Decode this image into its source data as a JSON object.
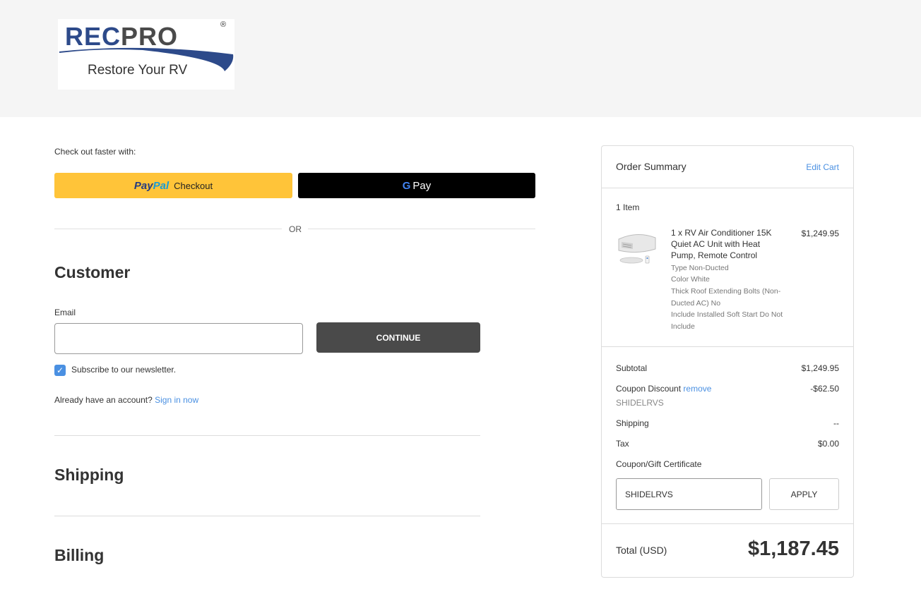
{
  "header": {
    "logo": {
      "brand_rec": "REC",
      "brand_pro": "PRO",
      "reg_mark": "®",
      "tagline": "Restore Your RV"
    }
  },
  "express": {
    "label": "Check out faster with:",
    "paypal": {
      "part1": "Pay",
      "part2": "Pal",
      "suffix": "Checkout"
    },
    "gpay": {
      "g": "G",
      "pay": "Pay"
    },
    "or": "OR"
  },
  "customer": {
    "title": "Customer",
    "email_label": "Email",
    "email_value": "",
    "continue_label": "CONTINUE",
    "subscribe_label": "Subscribe to our newsletter.",
    "subscribe_checked": true,
    "account_text": "Already have an account?",
    "sign_in_label": "Sign in now"
  },
  "shipping": {
    "title": "Shipping"
  },
  "billing": {
    "title": "Billing"
  },
  "order_summary": {
    "title": "Order Summary",
    "edit_cart": "Edit Cart",
    "item_count": "1 Item",
    "item": {
      "name": "1 x RV Air Conditioner 15K Quiet AC Unit with Heat Pump, Remote Control",
      "price": "$1,249.95",
      "options": [
        "Type Non-Ducted",
        "Color White",
        "Thick Roof Extending Bolts (Non-Ducted AC) No",
        "Include Installed Soft Start Do Not Include"
      ]
    },
    "subtotal_label": "Subtotal",
    "subtotal_value": "$1,249.95",
    "coupon_label": "Coupon Discount",
    "coupon_remove": "remove",
    "coupon_value": "-$62.50",
    "coupon_code": "SHIDELRVS",
    "shipping_label": "Shipping",
    "shipping_value": "--",
    "tax_label": "Tax",
    "tax_value": "$0.00",
    "gift_link": "Coupon/Gift Certificate",
    "coupon_input_value": "SHIDELRVS",
    "apply_label": "APPLY",
    "total_label": "Total (USD)",
    "total_value": "$1,187.45"
  },
  "colors": {
    "accent": "#4a90e2",
    "paypal": "#ffc439",
    "dark_button": "#4a4a4a",
    "header_bg": "#f5f5f5"
  }
}
